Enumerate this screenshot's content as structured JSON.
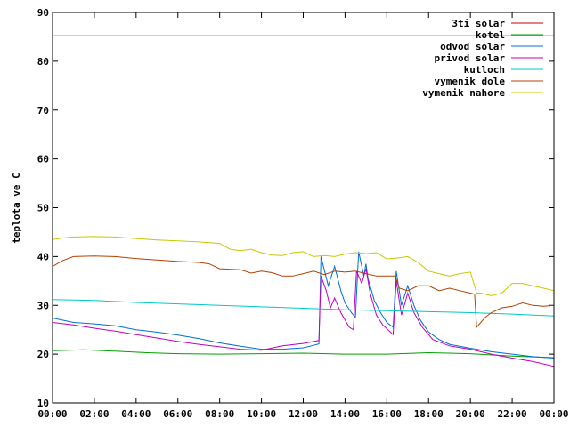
{
  "chart_data": {
    "type": "line",
    "title": "",
    "xlabel": "",
    "ylabel": "teplota ve C",
    "ylim": [
      10,
      90
    ],
    "yticks": [
      "10",
      "20",
      "30",
      "40",
      "50",
      "60",
      "70",
      "80",
      "90"
    ],
    "xticks": [
      "00:00",
      "02:00",
      "04:00",
      "06:00",
      "08:00",
      "10:00",
      "12:00",
      "14:00",
      "16:00",
      "18:00",
      "20:00",
      "22:00",
      "00:00"
    ],
    "xlim_hours": [
      0,
      24
    ],
    "grid": false,
    "legend_position": "top-right",
    "series": [
      {
        "name": "3ti solar",
        "color": "#cc0000",
        "points": [
          [
            0,
            85.2
          ],
          [
            24,
            85.2
          ]
        ]
      },
      {
        "name": "kotel",
        "color": "#00a000",
        "points": [
          [
            0,
            20.7
          ],
          [
            1.5,
            20.9
          ],
          [
            3,
            20.6
          ],
          [
            4.5,
            20.3
          ],
          [
            6,
            20.1
          ],
          [
            8,
            20.0
          ],
          [
            10,
            20.1
          ],
          [
            12,
            20.2
          ],
          [
            14,
            20.0
          ],
          [
            16,
            20.0
          ],
          [
            18,
            20.3
          ],
          [
            20,
            20.1
          ],
          [
            22,
            19.6
          ],
          [
            24,
            19.3
          ]
        ]
      },
      {
        "name": "odvod solar",
        "color": "#0070cc",
        "points": [
          [
            0,
            27.4
          ],
          [
            1,
            26.5
          ],
          [
            2,
            26.2
          ],
          [
            3,
            25.8
          ],
          [
            4,
            25.0
          ],
          [
            5,
            24.5
          ],
          [
            6,
            23.9
          ],
          [
            7,
            23.2
          ],
          [
            8,
            22.3
          ],
          [
            9,
            21.6
          ],
          [
            10,
            21.0
          ],
          [
            11,
            21.0
          ],
          [
            12,
            21.3
          ],
          [
            12.5,
            21.8
          ],
          [
            12.75,
            22.1
          ],
          [
            12.85,
            40.0
          ],
          [
            13.2,
            34.0
          ],
          [
            13.5,
            38.0
          ],
          [
            13.8,
            33.0
          ],
          [
            14.0,
            30.5
          ],
          [
            14.3,
            28.5
          ],
          [
            14.5,
            27.5
          ],
          [
            14.65,
            41.0
          ],
          [
            14.9,
            36.0
          ],
          [
            15.0,
            38.5
          ],
          [
            15.1,
            35.5
          ],
          [
            15.4,
            31.0
          ],
          [
            15.7,
            28.5
          ],
          [
            16.0,
            26.5
          ],
          [
            16.3,
            25.5
          ],
          [
            16.45,
            37.0
          ],
          [
            16.7,
            30.0
          ],
          [
            17.0,
            34.0
          ],
          [
            17.3,
            30.0
          ],
          [
            17.6,
            27.0
          ],
          [
            18.0,
            24.5
          ],
          [
            18.5,
            23.0
          ],
          [
            19,
            22.0
          ],
          [
            20,
            21.2
          ],
          [
            21,
            20.5
          ],
          [
            22,
            20.0
          ],
          [
            23,
            19.5
          ],
          [
            24,
            19.2
          ]
        ]
      },
      {
        "name": "privod solar",
        "color": "#c000c0",
        "points": [
          [
            0,
            26.5
          ],
          [
            1,
            26.0
          ],
          [
            2,
            25.3
          ],
          [
            3,
            24.7
          ],
          [
            4,
            24.0
          ],
          [
            5,
            23.3
          ],
          [
            6,
            22.6
          ],
          [
            7,
            22.0
          ],
          [
            8,
            21.5
          ],
          [
            9,
            21.0
          ],
          [
            10,
            20.8
          ],
          [
            11,
            21.7
          ],
          [
            12,
            22.2
          ],
          [
            12.75,
            22.8
          ],
          [
            12.85,
            36.0
          ],
          [
            13.1,
            33.0
          ],
          [
            13.3,
            29.5
          ],
          [
            13.5,
            31.5
          ],
          [
            13.8,
            28.5
          ],
          [
            14.2,
            25.5
          ],
          [
            14.4,
            25.0
          ],
          [
            14.55,
            37.0
          ],
          [
            14.8,
            34.5
          ],
          [
            15.0,
            37.5
          ],
          [
            15.2,
            32.5
          ],
          [
            15.5,
            28.0
          ],
          [
            15.8,
            26.0
          ],
          [
            16.3,
            24.0
          ],
          [
            16.45,
            35.0
          ],
          [
            16.7,
            28.0
          ],
          [
            17.0,
            32.5
          ],
          [
            17.3,
            28.5
          ],
          [
            17.7,
            25.5
          ],
          [
            18.2,
            23.0
          ],
          [
            19,
            21.7
          ],
          [
            20,
            21.0
          ],
          [
            21,
            20.0
          ],
          [
            22,
            19.2
          ],
          [
            23,
            18.5
          ],
          [
            24,
            17.5
          ]
        ]
      },
      {
        "name": "kutloch",
        "color": "#00c8c8",
        "points": [
          [
            0,
            31.2
          ],
          [
            2,
            31.0
          ],
          [
            4,
            30.6
          ],
          [
            6,
            30.3
          ],
          [
            8,
            30.0
          ],
          [
            10,
            29.7
          ],
          [
            12,
            29.4
          ],
          [
            14,
            29.1
          ],
          [
            16,
            28.9
          ],
          [
            18,
            28.7
          ],
          [
            20,
            28.5
          ],
          [
            22,
            28.2
          ],
          [
            24,
            27.8
          ]
        ]
      },
      {
        "name": "vymenik dole",
        "color": "#b44000",
        "points": [
          [
            0,
            38.0
          ],
          [
            0.5,
            39.2
          ],
          [
            1,
            40.0
          ],
          [
            2,
            40.1
          ],
          [
            3,
            40.0
          ],
          [
            4,
            39.6
          ],
          [
            5,
            39.3
          ],
          [
            6,
            39.0
          ],
          [
            7,
            38.8
          ],
          [
            7.5,
            38.5
          ],
          [
            8,
            37.5
          ],
          [
            9,
            37.3
          ],
          [
            9.5,
            36.6
          ],
          [
            10,
            37.0
          ],
          [
            10.5,
            36.7
          ],
          [
            11,
            36.0
          ],
          [
            11.5,
            36.0
          ],
          [
            12,
            36.5
          ],
          [
            12.5,
            37.0
          ],
          [
            13,
            36.3
          ],
          [
            13.5,
            37.0
          ],
          [
            14,
            36.8
          ],
          [
            14.5,
            37.0
          ],
          [
            15,
            36.5
          ],
          [
            15.5,
            36.0
          ],
          [
            16,
            36.0
          ],
          [
            16.4,
            36.0
          ],
          [
            16.6,
            33.5
          ],
          [
            17,
            33.0
          ],
          [
            17.5,
            34.0
          ],
          [
            18,
            34.0
          ],
          [
            18.5,
            33.0
          ],
          [
            19,
            33.5
          ],
          [
            19.5,
            33.0
          ],
          [
            20,
            32.5
          ],
          [
            20.2,
            32.3
          ],
          [
            20.3,
            25.5
          ],
          [
            20.7,
            27.5
          ],
          [
            21,
            28.5
          ],
          [
            21.5,
            29.5
          ],
          [
            22,
            29.8
          ],
          [
            22.5,
            30.5
          ],
          [
            23,
            30.0
          ],
          [
            23.5,
            29.8
          ],
          [
            24,
            30.0
          ]
        ]
      },
      {
        "name": "vymenik nahore",
        "color": "#c8c800",
        "points": [
          [
            0,
            43.5
          ],
          [
            0.5,
            43.8
          ],
          [
            1,
            44.0
          ],
          [
            2,
            44.1
          ],
          [
            3,
            44.0
          ],
          [
            4,
            43.7
          ],
          [
            5,
            43.4
          ],
          [
            6,
            43.2
          ],
          [
            7,
            43.0
          ],
          [
            8,
            42.7
          ],
          [
            8.5,
            41.5
          ],
          [
            9,
            41.2
          ],
          [
            9.5,
            41.5
          ],
          [
            10,
            40.8
          ],
          [
            10.5,
            40.3
          ],
          [
            11,
            40.2
          ],
          [
            11.5,
            40.8
          ],
          [
            12,
            41.0
          ],
          [
            12.5,
            40.0
          ],
          [
            13,
            40.2
          ],
          [
            13.5,
            40.0
          ],
          [
            14,
            40.5
          ],
          [
            14.5,
            40.8
          ],
          [
            15,
            40.6
          ],
          [
            15.5,
            40.8
          ],
          [
            16,
            39.5
          ],
          [
            16.5,
            39.7
          ],
          [
            17,
            40.0
          ],
          [
            17.5,
            38.8
          ],
          [
            18,
            37.0
          ],
          [
            18.5,
            36.5
          ],
          [
            19,
            36.0
          ],
          [
            19.5,
            36.5
          ],
          [
            20,
            36.8
          ],
          [
            20.3,
            32.5
          ],
          [
            20.5,
            32.5
          ],
          [
            21,
            32.0
          ],
          [
            21.5,
            32.5
          ],
          [
            22,
            34.5
          ],
          [
            22.5,
            34.5
          ],
          [
            23,
            34.0
          ],
          [
            23.5,
            33.5
          ],
          [
            24,
            33.0
          ]
        ]
      }
    ]
  }
}
